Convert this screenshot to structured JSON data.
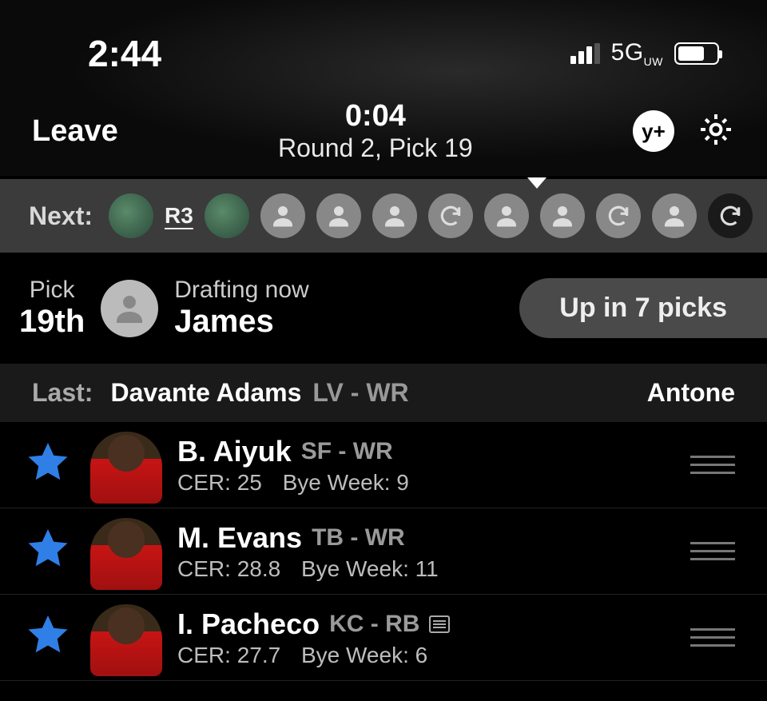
{
  "status": {
    "time": "2:44",
    "network": "5G",
    "network_sub": "UW"
  },
  "top": {
    "leave": "Leave",
    "timer": "0:04",
    "round_pick": "Round 2, Pick 19",
    "yplus": "y+"
  },
  "next": {
    "label": "Next:",
    "r3": "R3"
  },
  "drafting": {
    "pick_label": "Pick",
    "pick_num": "19th",
    "drafting_now": "Drafting now",
    "name": "James",
    "up_in": "Up in 7 picks"
  },
  "last": {
    "label": "Last:",
    "player": "Davante Adams",
    "pos": "LV - WR",
    "by": "Antone"
  },
  "players": [
    {
      "name": "B. Aiyuk",
      "pos": "SF - WR",
      "cer": "25",
      "bye": "9",
      "note": false
    },
    {
      "name": "M. Evans",
      "pos": "TB - WR",
      "cer": "28.8",
      "bye": "11",
      "note": false
    },
    {
      "name": "I. Pacheco",
      "pos": "KC - RB",
      "cer": "27.7",
      "bye": "6",
      "note": true
    }
  ],
  "labels": {
    "cer": "CER:",
    "bye": "Bye Week:"
  }
}
